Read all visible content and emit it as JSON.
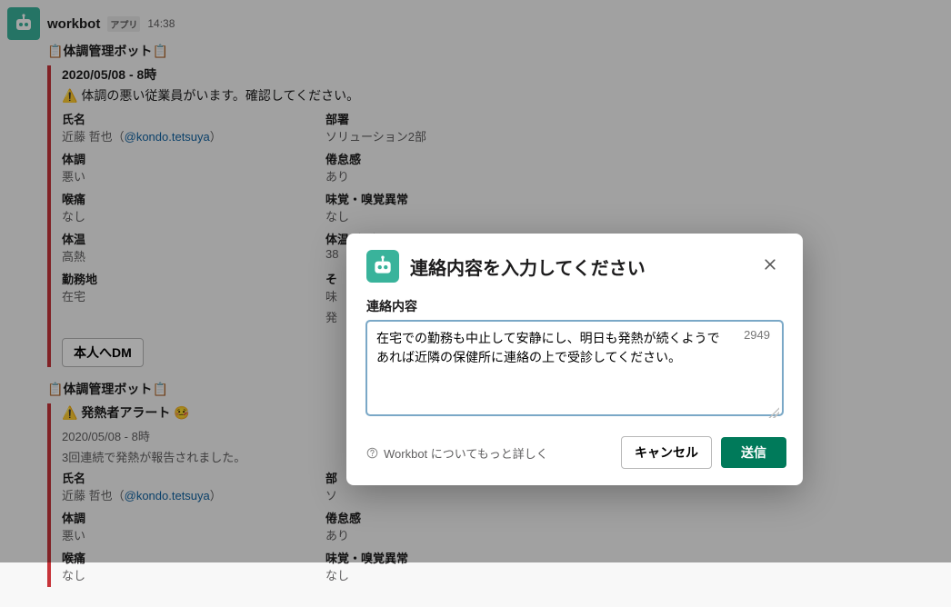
{
  "message": {
    "username": "workbot",
    "app_badge": "アプリ",
    "timestamp": "14:38",
    "bot_title_prefix": "📋",
    "bot_title": "体調管理ボット",
    "bot_title_suffix": "📋"
  },
  "block1": {
    "date": "2020/05/08 - 8時",
    "alert_text": "体調の悪い従業員がいます。確認してください。",
    "fields": [
      {
        "label": "氏名",
        "value_pre": "近藤 哲也（",
        "mention": "@kondo.tetsuya",
        "value_post": "）"
      },
      {
        "label": "部署",
        "value": "ソリューション2部"
      },
      {
        "label": "体調",
        "value": "悪い"
      },
      {
        "label": "倦怠感",
        "value": "あり"
      },
      {
        "label": "喉痛",
        "value": "なし"
      },
      {
        "label": "味覚・嗅覚異常",
        "value": "なし"
      },
      {
        "label": "体温",
        "value": "高熱"
      },
      {
        "label": "体温（℃）",
        "value": "38"
      },
      {
        "label": "勤務地",
        "value": "在宅"
      },
      {
        "label": "そ",
        "value_pre": "味",
        "value2": "発"
      }
    ],
    "dm_button": "本人へDM"
  },
  "block2": {
    "bot_title_prefix": "📋",
    "bot_title": "体調管理ボット",
    "bot_title_suffix": "📋",
    "alert_label": "発熱者アラート",
    "date": "2020/05/08 - 8時",
    "summary": "3回連続で発熱が報告されました。",
    "fields": [
      {
        "label": "氏名",
        "value_pre": "近藤 哲也（",
        "mention": "@kondo.tetsuya",
        "value_post": "）"
      },
      {
        "label": "部",
        "value": "ソ"
      },
      {
        "label": "体調",
        "value": "悪い"
      },
      {
        "label": "倦怠感",
        "value": "あり"
      },
      {
        "label": "喉痛",
        "value": "なし"
      },
      {
        "label": "味覚・嗅覚異常",
        "value": "なし"
      }
    ]
  },
  "modal": {
    "title": "連絡内容を入力してください",
    "field_label": "連絡内容",
    "textarea_value": "在宅での勤務も中止して安静にし、明日も発熱が続くようであれば近隣の保健所に連絡の上で受診してください。",
    "counter": "2949",
    "learn_more": "Workbot についてもっと詳しく",
    "cancel": "キャンセル",
    "send": "送信"
  },
  "icons": {
    "warning": "⚠️",
    "sick": "🤒"
  }
}
